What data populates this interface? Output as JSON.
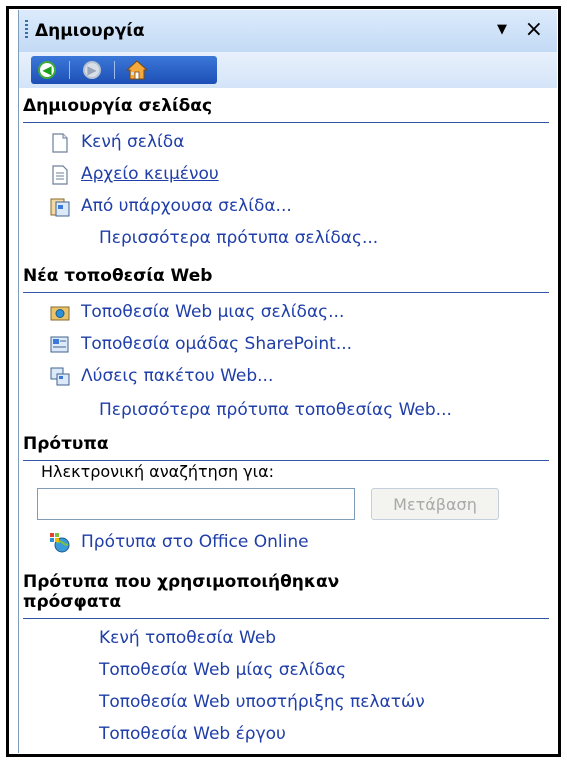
{
  "taskpane": {
    "title": "Δημιουργία",
    "menu_icon": "dropdown-arrow",
    "close_label": "×"
  },
  "nav": {
    "back_icon": "back-arrow",
    "forward_icon": "forward-arrow",
    "home_icon": "home"
  },
  "sections": {
    "create_page": {
      "title": "Δημιουργία σελίδας",
      "items": [
        {
          "label": "Κενή σελίδα",
          "icon": "blank-page"
        },
        {
          "label": "Αρχείο κειμένου",
          "icon": "text-file"
        },
        {
          "label": "Από υπάρχουσα σελίδα...",
          "icon": "existing-page"
        },
        {
          "label": "Περισσότερα πρότυπα σελίδας...",
          "icon": ""
        }
      ]
    },
    "new_site": {
      "title": "Νέα τοποθεσία Web",
      "items": [
        {
          "label": "Τοποθεσία Web μιας σελίδας...",
          "icon": "single-page-site"
        },
        {
          "label": "Τοποθεσία ομάδας SharePoint...",
          "icon": "sharepoint-team-site"
        },
        {
          "label": "Λύσεις πακέτου Web...",
          "icon": "web-package"
        },
        {
          "label": "Περισσότερα πρότυπα τοποθεσίας Web...",
          "icon": ""
        }
      ]
    },
    "templates": {
      "title": "Πρότυπα",
      "search_label": "Ηλεκτρονική αναζήτηση για:",
      "search_value": "",
      "go_button": "Μετάβαση",
      "online_link": "Πρότυπα στο Office Online",
      "online_icon": "office-online"
    },
    "recent": {
      "title_line1": "Πρότυπα που χρησιμοποιήθηκαν",
      "title_line2": "πρόσφατα",
      "items": [
        "Κενή τοποθεσία Web",
        "Τοποθεσία Web μίας σελίδας",
        "Τοποθεσία Web υποστήριξης πελατών",
        "Τοποθεσία Web έργου"
      ]
    }
  },
  "colors": {
    "link": "#1f3ea8",
    "section_rule": "#2f55a4",
    "titlebar": "#c3daf5",
    "navgroup": "#1d4fb6"
  }
}
